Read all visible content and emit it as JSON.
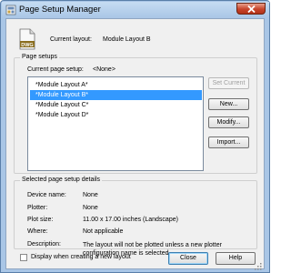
{
  "window": {
    "title": "Page Setup Manager"
  },
  "current_layout": {
    "label": "Current layout:",
    "value": "Module Layout B",
    "icon": "dwg-file-icon",
    "icon_text": "DWG"
  },
  "page_setups": {
    "group_title": "Page setups",
    "current_label": "Current page setup:",
    "current_value": "<None>",
    "items": [
      {
        "label": "*Module Layout A*",
        "selected": false
      },
      {
        "label": "*Module Layout B*",
        "selected": true
      },
      {
        "label": "*Module Layout C*",
        "selected": false
      },
      {
        "label": "*Module Layout D*",
        "selected": false
      }
    ],
    "buttons": {
      "set_current": "Set Current",
      "new": "New...",
      "modify": "Modify...",
      "import": "Import..."
    }
  },
  "details": {
    "group_title": "Selected page setup details",
    "device_name_label": "Device name:",
    "device_name_value": "None",
    "plotter_label": "Plotter:",
    "plotter_value": "None",
    "plot_size_label": "Plot size:",
    "plot_size_value": "11.00 x 17.00 inches (Landscape)",
    "where_label": "Where:",
    "where_value": "Not applicable",
    "description_label": "Description:",
    "description_value": "The layout will not be plotted unless a new plotter configuration name is selected."
  },
  "footer": {
    "checkbox_label": "Display when creating a new layout",
    "checkbox_checked": false,
    "close_label": "Close",
    "help_label": "Help"
  },
  "colors": {
    "selection": "#3399ff",
    "frame": "#a9c6e6",
    "close_button": "#c7432a"
  }
}
